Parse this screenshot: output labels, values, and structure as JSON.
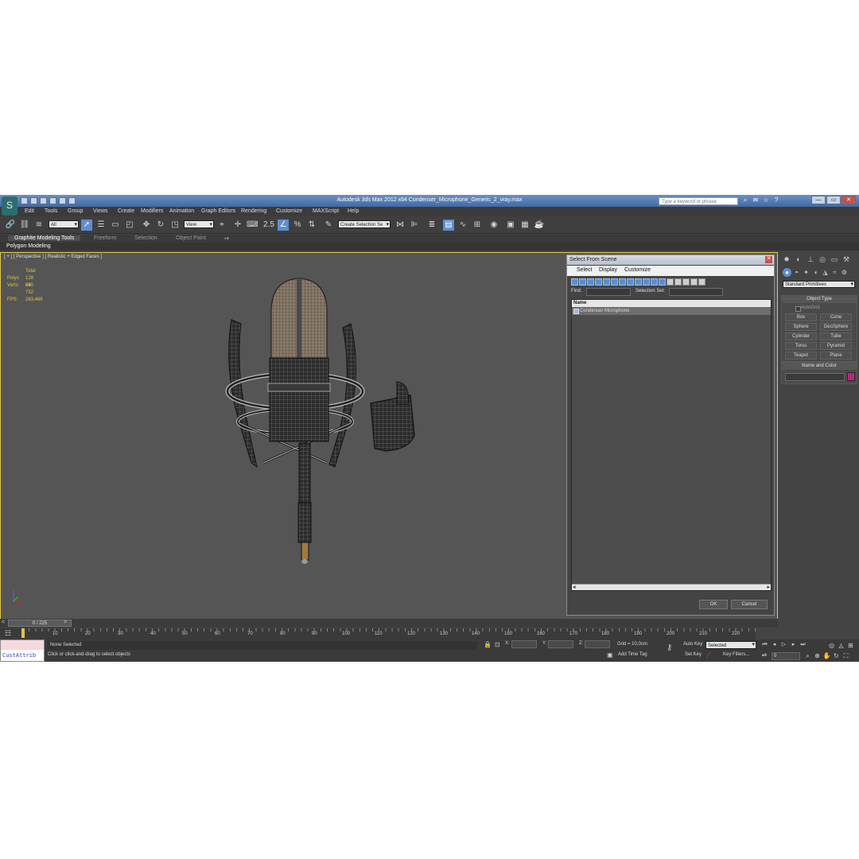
{
  "window": {
    "title": "Autodesk 3ds Max  2012 x64      Condenser_Microphone_Generic_2_vray.max",
    "search_placeholder": "Type a keyword or phrase",
    "logo_glyph": "S",
    "icons": [
      "binoculars-icon",
      "star-icon",
      "help-icon"
    ],
    "controls": {
      "minimize": "—",
      "maximize": "▭",
      "close": "✕"
    }
  },
  "menu": [
    "Edit",
    "Tools",
    "Group",
    "Views",
    "Create",
    "Modifiers",
    "Animation",
    "Graph Editors",
    "Rendering",
    "Customize",
    "MAXScript",
    "Help"
  ],
  "toolbar": {
    "filter_value": "All",
    "view_value": "View",
    "selection_set_value": "Create Selection Se",
    "snap_label": "2.5",
    "angle_snap_label": "%"
  },
  "ribbon": {
    "tabs": [
      "Graphite Modeling Tools",
      "Freeform",
      "Selection",
      "Object Paint"
    ],
    "active_tab": "Graphite Modeling Tools",
    "sub_label": "Polygon Modeling"
  },
  "viewport": {
    "label": "[ + ] [ Perspective ] [ Realistic + Edged Faces ]",
    "stats": {
      "total_label": "Total",
      "polys_label": "Polys:",
      "polys_value": "128 690",
      "verts_label": "Verts:",
      "verts_value": "64 732",
      "fps_label": "FPS:",
      "fps_value": "263,466"
    },
    "colors": {
      "background": "#555555",
      "border": "#e6c84a",
      "stats": "#e0c440"
    }
  },
  "select_dialog": {
    "title": "Select From Scene",
    "menu": [
      "Select",
      "Display",
      "Customize"
    ],
    "find_label": "Find:",
    "selection_set_label": "Selection Set:",
    "column_header": "Name",
    "objects": [
      "Condenser Microphone"
    ],
    "ok_label": "OK",
    "cancel_label": "Cancel"
  },
  "command_panel": {
    "category": "Standard Primitives",
    "object_type_title": "Object Type",
    "autogrid_label": "AutoGrid",
    "primitives": [
      "Box",
      "Cone",
      "Sphere",
      "GeoSphere",
      "Cylinder",
      "Tube",
      "Torus",
      "Pyramid",
      "Teapot",
      "Plane"
    ],
    "name_color_title": "Name and Color",
    "swatch_color": "#c0247d"
  },
  "timeline": {
    "frame_label": "0 / 225",
    "ticks": [
      "10",
      "20",
      "30",
      "40",
      "50",
      "60",
      "70",
      "80",
      "90",
      "100",
      "110",
      "120",
      "130",
      "140",
      "150",
      "160",
      "170",
      "180",
      "190",
      "200",
      "210",
      "220"
    ]
  },
  "status": {
    "custattrib_label": "CustAttrib",
    "selection_status": "None Selected",
    "prompt": "Click or click-and-drag to select objects",
    "x_label": "X:",
    "y_label": "Y:",
    "z_label": "Z:",
    "grid_label": "Grid = 10,0cm",
    "add_time_tag": "Add Time Tag",
    "auto_key": "Auto Key",
    "set_key": "Set Key",
    "selected_value": "Selected",
    "key_filters": "Key Filters...",
    "frame_value": "0"
  }
}
